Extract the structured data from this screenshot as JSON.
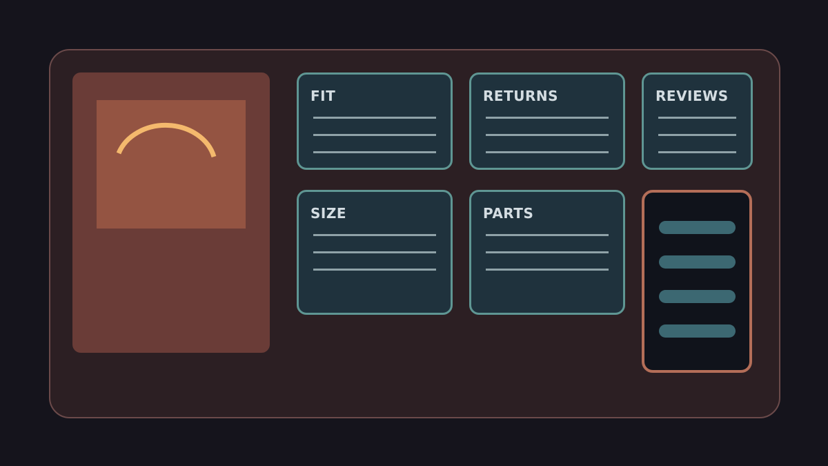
{
  "colors": {
    "background": "#15141c",
    "frame": "#2c1f23",
    "frame_border": "#6b4a4a",
    "media_panel": "#6a3c37",
    "media_image": "#945442",
    "arc_accent": "#f4b96d",
    "card_background": "#1f323d",
    "card_border": "#5f9693",
    "card_title": "#d4dde2",
    "card_line": "#8fa2a8",
    "menu_background": "#10131b",
    "menu_border": "#b46e58",
    "menu_pill": "#3c6872"
  },
  "media": {
    "icon": "arc-icon"
  },
  "cards": [
    {
      "title": "FIT"
    },
    {
      "title": "RETURNS"
    },
    {
      "title": "REVIEWS"
    },
    {
      "title": "SIZE"
    },
    {
      "title": "PARTS"
    }
  ],
  "menu": {
    "icon": "menu-icon",
    "items": 4
  }
}
